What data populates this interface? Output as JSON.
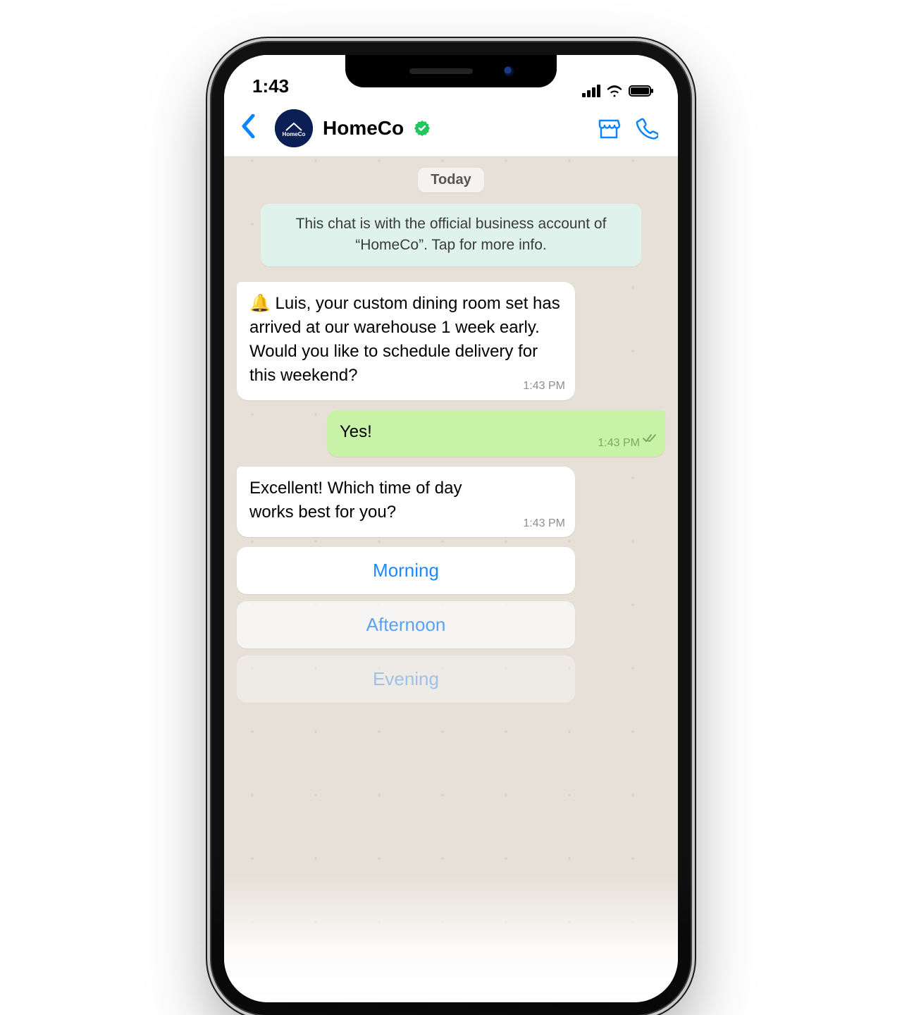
{
  "statusbar": {
    "time": "1:43"
  },
  "header": {
    "contact_name": "HomeCo",
    "avatar_text": "HomeCo"
  },
  "chat": {
    "date_label": "Today",
    "info_banner": "This chat is with the official business account of “HomeCo”. Tap for more info.",
    "messages": [
      {
        "text": "🔔 Luis, your custom dining room set has arrived at our warehouse 1 week early. Would you like to schedule delivery for this weekend?",
        "time": "1:43 PM"
      },
      {
        "text": "Yes!",
        "time": "1:43 PM"
      },
      {
        "text": "Excellent! Which time of day works best for you?",
        "time": "1:43 PM"
      }
    ],
    "quick_replies": [
      "Morning",
      "Afternoon",
      "Evening"
    ]
  }
}
